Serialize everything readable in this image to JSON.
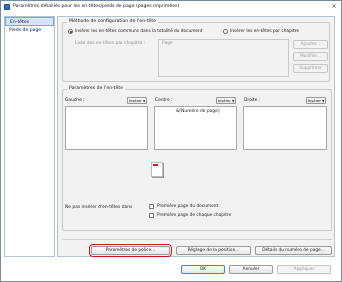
{
  "window": {
    "title": "Paramètres détaillés pour les en-têtes/pieds de page (pages imprimées)",
    "close_glyph": "×"
  },
  "sidebar": {
    "items": [
      {
        "label": "En-têtes",
        "selected": true
      },
      {
        "label": "Pieds de page",
        "selected": false
      }
    ]
  },
  "config": {
    "legend": "Méthode de configuration de l'en-tête",
    "radio_all": "Insérer les en-têtes communs dans la totalité du document",
    "radio_per_chapter": "Insérer les en-têtes par chapitre",
    "list_label": "Liste des en-têtes par chapitre :",
    "list_value": "Page",
    "btn_add": "Ajouter...",
    "btn_modify": "Modifier...",
    "btn_delete": "Supprimer"
  },
  "header_params": {
    "legend": "Paramètres de l'en-tête",
    "left_label": "Gauche :",
    "center_label": "Centre :",
    "right_label": "Droite :",
    "insert_label": "Insérer",
    "center_value": "&[Numéro de page]",
    "no_insert_label": "Ne pas insérer d'en-têtes dans",
    "checkbox_first_page_doc": "Première page du document",
    "checkbox_first_page_chapter": "Première page de chaque chapitre"
  },
  "buttons": {
    "font_settings": "Paramètres de police...",
    "position_settings": "Réglage de la position...",
    "page_number_details": "Détails du numéro de page...",
    "ok": "OK",
    "cancel": "Annuler",
    "apply": "Appliquer"
  },
  "colors": {
    "highlight": "#d8141e",
    "selection": "#d5e5f8"
  }
}
